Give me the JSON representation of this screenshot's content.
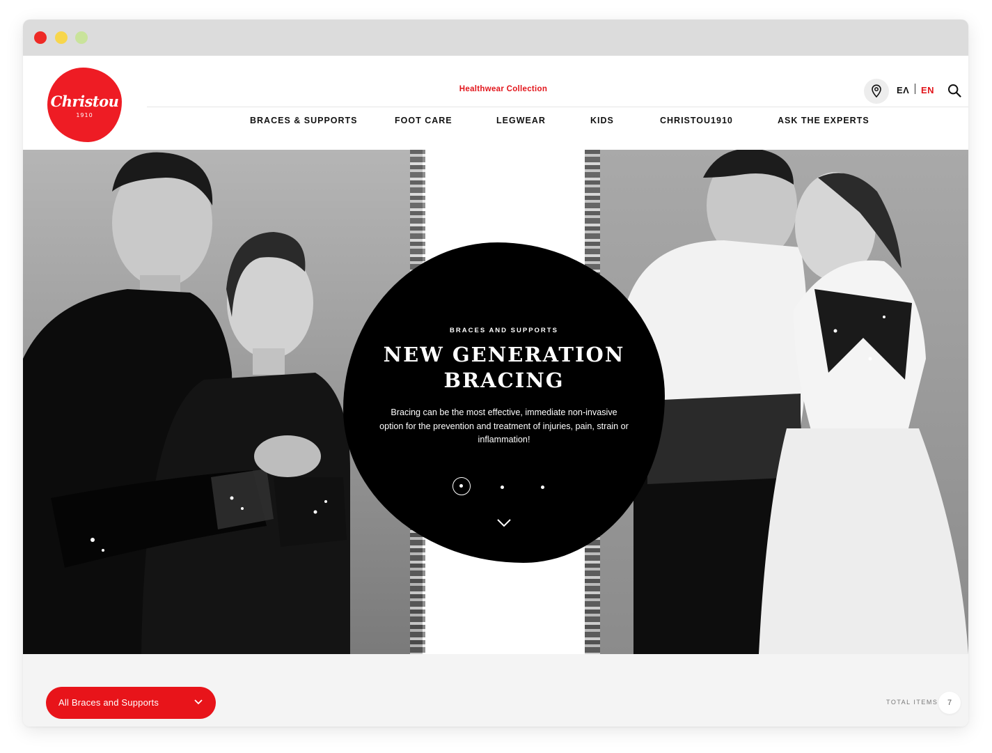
{
  "brand": {
    "logo_word": "Christou",
    "logo_year": "1910",
    "color": "#ee1c24"
  },
  "header": {
    "collection_label": "Healthwear Collection",
    "location_icon": "map-pin-icon",
    "languages": [
      "ΕΛ",
      "EN"
    ],
    "active_language": "EN",
    "search_icon": "search-icon",
    "nav": [
      "BRACES & SUPPORTS",
      "FOOT CARE",
      "LEGWEAR",
      "KIDS",
      "CHRISTOU1910",
      "ASK THE EXPERTS"
    ]
  },
  "hero": {
    "eyebrow": "BRACES AND SUPPORTS",
    "title": "NEW GENERATION BRACING",
    "description": "Bracing can be the most effective, immediate non-invasive option for the prevention and treatment of injuries, pain, strain or inflammation!",
    "slides_total": 3,
    "active_slide": 1,
    "scroll_icon": "chevron-down-icon"
  },
  "listing": {
    "filter_label": "All Braces and Supports",
    "total_label": "TOTAL ITEMS",
    "total_count": "7"
  },
  "colors": {
    "accent": "#e2151b",
    "text": "#111111",
    "panel": "#f4f4f4"
  }
}
